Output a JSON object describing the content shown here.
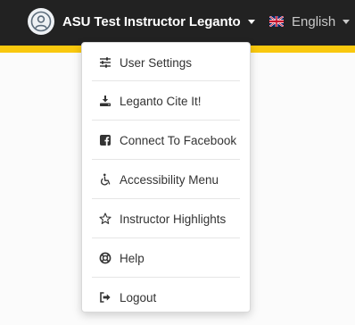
{
  "header": {
    "user_name": "ASU Test Instructor Leganto",
    "language": "English"
  },
  "menu": {
    "items": [
      {
        "label": "User Settings",
        "icon": "sliders-icon"
      },
      {
        "label": "Leganto Cite It!",
        "icon": "download-icon"
      },
      {
        "label": "Connect To Facebook",
        "icon": "facebook-icon"
      },
      {
        "label": "Accessibility Menu",
        "icon": "wheelchair-icon"
      },
      {
        "label": "Instructor Highlights",
        "icon": "star-icon"
      },
      {
        "label": "Help",
        "icon": "lifebuoy-icon"
      },
      {
        "label": "Logout",
        "icon": "logout-icon"
      }
    ]
  },
  "colors": {
    "topbar": "#222222",
    "accent": "#f9c80e",
    "menu_text": "#333333"
  }
}
